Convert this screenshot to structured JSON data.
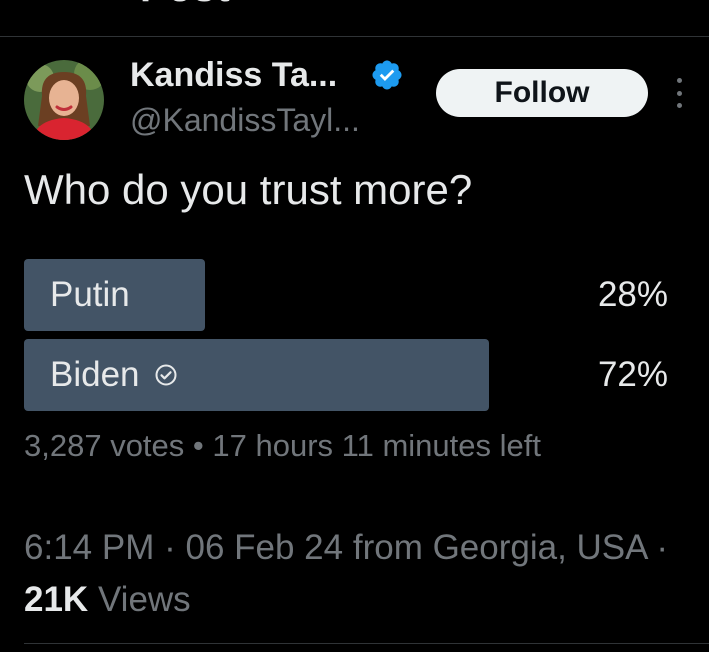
{
  "header": {
    "title_partial": "Post"
  },
  "author": {
    "name": "Kandiss Ta...",
    "handle": "@KandissTayl...",
    "verified": true,
    "verified_color": "#1d9bf0"
  },
  "follow_button": {
    "label": "Follow"
  },
  "tweet": {
    "text": "Who do you trust more?"
  },
  "poll": {
    "options": [
      {
        "label": "Putin",
        "percent_label": "28%",
        "percent": 28,
        "winner": false
      },
      {
        "label": "Biden",
        "percent_label": "72%",
        "percent": 72,
        "winner": true
      }
    ],
    "votes": "3,287 votes",
    "separator": "•",
    "time_left": "17 hours 11 minutes left",
    "fill_color": "#435466"
  },
  "meta": {
    "time": "6:14 PM",
    "dot": "·",
    "date": "06 Feb 24",
    "source": "from Georgia, USA",
    "views_count": "21K",
    "views_label": "Views"
  },
  "colors": {
    "background": "#000000",
    "text": "#e7e9ea",
    "muted": "#71767b",
    "accent": "#1d9bf0"
  }
}
